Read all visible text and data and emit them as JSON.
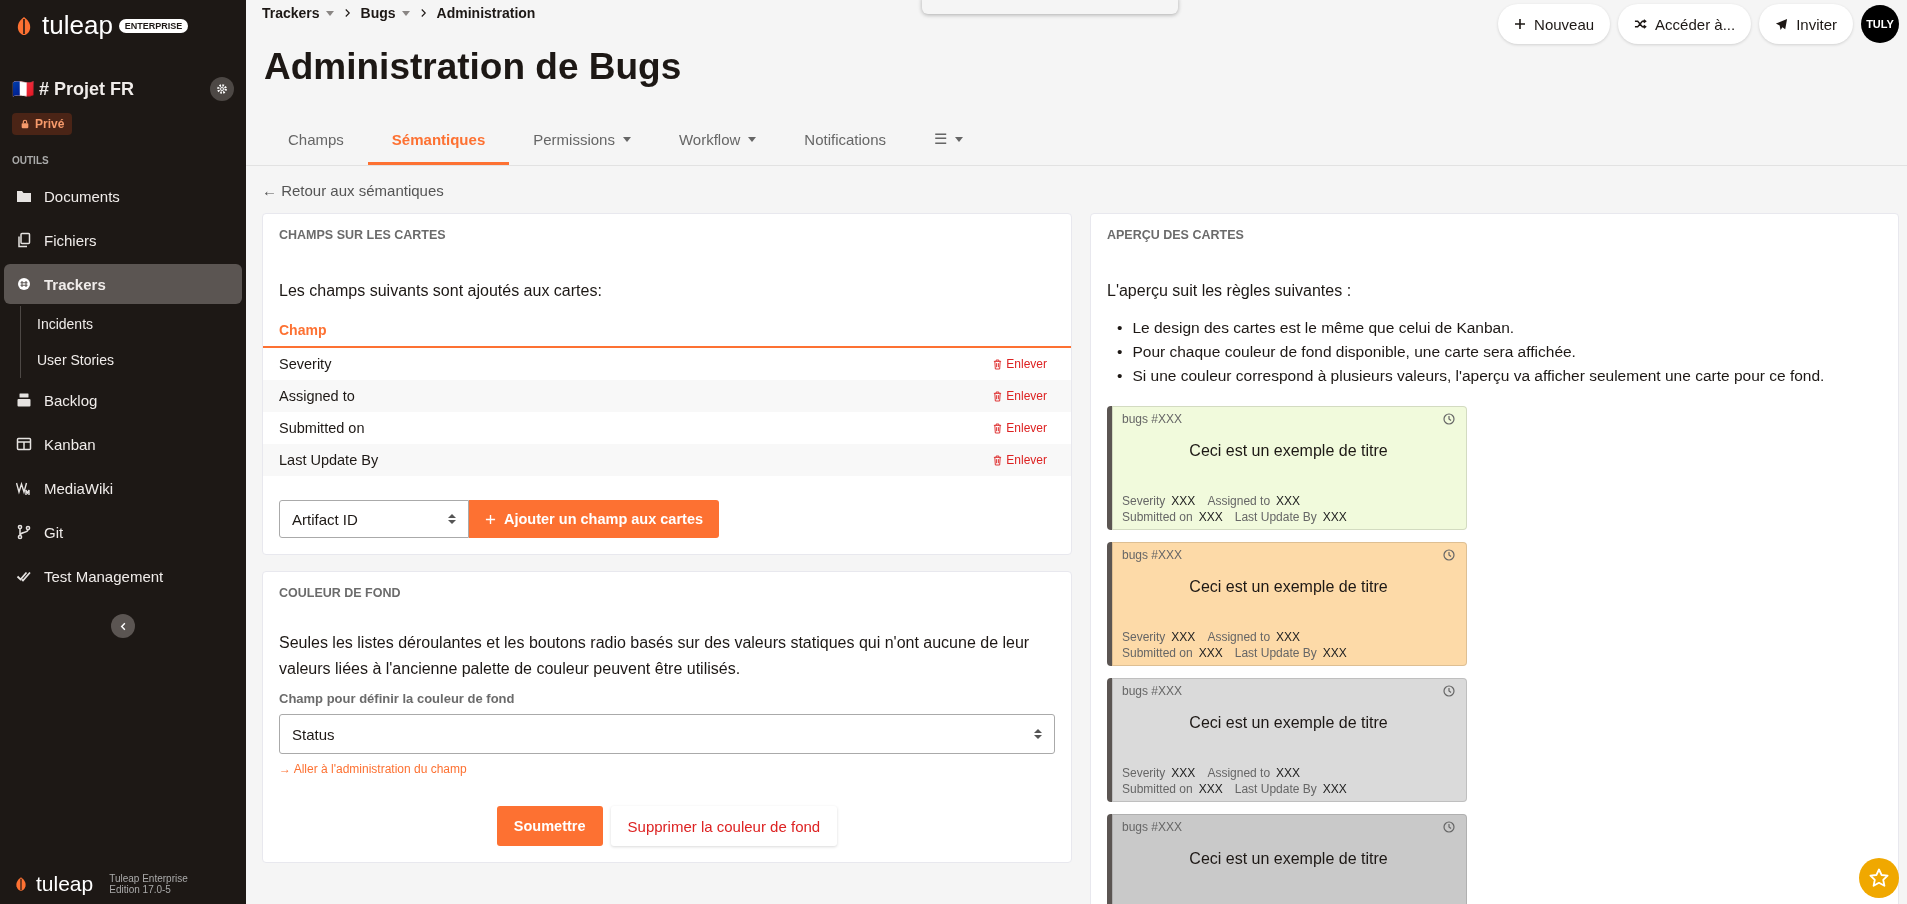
{
  "sidebar": {
    "brand": "tuleap",
    "edition_badge": "ENTERPRISE",
    "project": {
      "flag": "🇫🇷",
      "name": "# Projet FR"
    },
    "privacy_badge": "Privé",
    "section_label": "OUTILS",
    "items": [
      {
        "label": "Documents",
        "selected": false
      },
      {
        "label": "Fichiers",
        "selected": false
      },
      {
        "label": "Trackers",
        "selected": true,
        "children": [
          {
            "label": "Incidents",
            "selected": false
          },
          {
            "label": "User Stories",
            "selected": false
          }
        ]
      },
      {
        "label": "Backlog",
        "selected": false
      },
      {
        "label": "Kanban",
        "selected": false
      },
      {
        "label": "MediaWiki",
        "selected": false
      },
      {
        "label": "Git",
        "selected": false
      },
      {
        "label": "Test Management",
        "selected": false
      }
    ],
    "footer_brand": "tuleap",
    "footer_version": "Tuleap Enterprise Edition 17.0-5"
  },
  "breadcrumb": [
    {
      "label": "Trackers",
      "menu": true
    },
    {
      "label": "Bugs",
      "menu": true
    },
    {
      "label": "Administration",
      "menu": false
    }
  ],
  "header_buttons": [
    {
      "label": "Nouveau"
    },
    {
      "label": "Accéder à..."
    },
    {
      "label": "Inviter"
    }
  ],
  "avatar": "TULY",
  "title": "Administration de Bugs",
  "tabs": [
    {
      "label": "Champs",
      "selected": false,
      "menu": false
    },
    {
      "label": "Sémantiques",
      "selected": true,
      "menu": false
    },
    {
      "label": "Permissions",
      "selected": false,
      "menu": true
    },
    {
      "label": "Workflow",
      "selected": false,
      "menu": true
    },
    {
      "label": "Notifications",
      "selected": false,
      "menu": false
    },
    {
      "label": "☰",
      "selected": false,
      "menu": true
    }
  ],
  "back_link": "← Retour aux sémantiques",
  "card_fields": {
    "heading": "CHAMPS SUR LES CARTES",
    "intro": "Les champs suivants sont ajoutés aux cartes:",
    "column": "Champ",
    "rows": [
      {
        "name": "Severity",
        "action": "Enlever"
      },
      {
        "name": "Assigned to",
        "action": "Enlever"
      },
      {
        "name": "Submitted on",
        "action": "Enlever"
      },
      {
        "name": "Last Update By",
        "action": "Enlever"
      }
    ],
    "select_value": "Artifact ID",
    "add_button": "Ajouter un champ aux cartes"
  },
  "background": {
    "heading": "COULEUR DE FOND",
    "text": "Seules les listes déroulantes et les boutons radio basés sur des valeurs statiques qui n'ont aucune de leur valeurs liées à l'ancienne palette de couleur peuvent être utilisés.",
    "field_label": "Champ pour définir la couleur de fond",
    "select_value": "Status",
    "admin_link": "→ Aller à l'administration du champ",
    "submit": "Soumettre",
    "remove": "Supprimer la couleur de fond"
  },
  "preview": {
    "heading": "APERÇU DES CARTES",
    "intro": "L'aperçu suit les règles suivantes :",
    "rules": [
      {
        "marker": "•",
        "text": "Le design des cartes est le même que celui de Kanban."
      },
      {
        "marker": "•",
        "text": "Pour chaque couleur de fond disponible, une carte sera affichée."
      },
      {
        "marker": "•",
        "text": "Si une couleur correspond à plusieurs valeurs, l'aperçu va afficher seulement une carte pour ce fond."
      }
    ],
    "cards": [
      {
        "ref": "bugs #XXX",
        "title": "Ceci est un exemple de titre",
        "color": "#f1fadc",
        "fields": [
          {
            "label": "Severity",
            "value": "XXX"
          },
          {
            "label": "Assigned to",
            "value": "XXX"
          },
          {
            "label": "Submitted on",
            "value": "XXX"
          },
          {
            "label": "Last Update By",
            "value": "XXX"
          }
        ]
      },
      {
        "ref": "bugs #XXX",
        "title": "Ceci est un exemple de titre",
        "color": "#fddaa8",
        "fields": [
          {
            "label": "Severity",
            "value": "XXX"
          },
          {
            "label": "Assigned to",
            "value": "XXX"
          },
          {
            "label": "Submitted on",
            "value": "XXX"
          },
          {
            "label": "Last Update By",
            "value": "XXX"
          }
        ]
      },
      {
        "ref": "bugs #XXX",
        "title": "Ceci est un exemple de titre",
        "color": "#dadada",
        "fields": [
          {
            "label": "Severity",
            "value": "XXX"
          },
          {
            "label": "Assigned to",
            "value": "XXX"
          },
          {
            "label": "Submitted on",
            "value": "XXX"
          },
          {
            "label": "Last Update By",
            "value": "XXX"
          }
        ]
      },
      {
        "ref": "bugs #XXX",
        "title": "Ceci est un exemple de titre",
        "color": "#c9c9c9"
      }
    ]
  }
}
